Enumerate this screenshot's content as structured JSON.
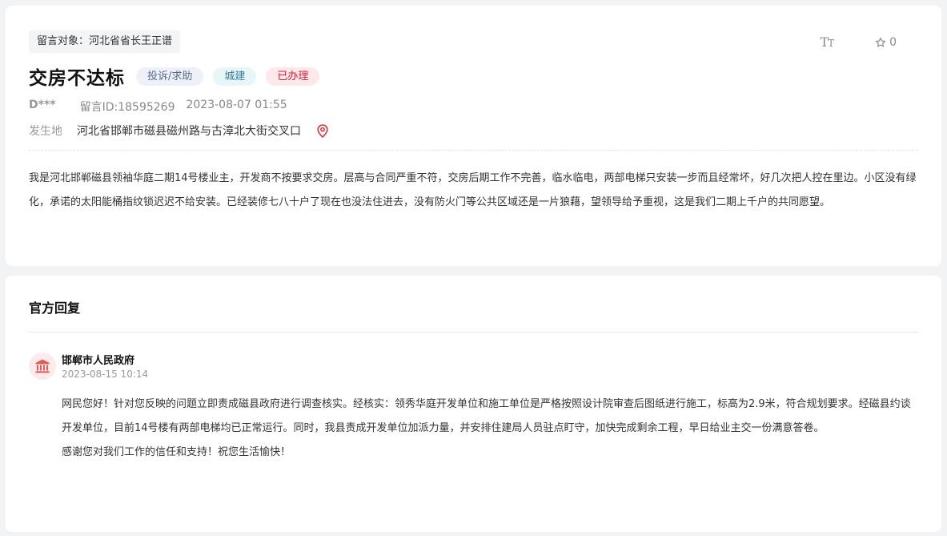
{
  "petition": {
    "target_label": "留言对象：河北省省长王正谱",
    "font_toggle": {
      "big": "T",
      "small": "T"
    },
    "favorite_count": "0",
    "title": "交房不达标",
    "badges": {
      "type": "投诉/求助",
      "category": "城建",
      "status": "已办理"
    },
    "author": "D***",
    "message_id": "留言ID:18595269",
    "datetime": "2023-08-07 01:55",
    "location_label": "发生地",
    "location_value": "河北省邯郸市磁县磁州路与古漳北大街交叉口",
    "content": "我是河北邯郸磁县领袖华庭二期14号楼业主，开发商不按要求交房。层高与合同严重不符，交房后期工作不完善，临水临电，两部电梯只安装一步而且经常坏，好几次把人控在里边。小区没有绿化，承诺的太阳能桶指纹锁迟迟不给安装。已经装修七八十户了现在也没法住进去，没有防火门等公共区域还是一片狼藉，望领导给予重视，这是我们二期上千户的共同愿望。"
  },
  "reply": {
    "heading": "官方回复",
    "org_name": "邯郸市人民政府",
    "datetime": "2023-08-15 10:14",
    "body": "网民您好！针对您反映的问题立即责成磁县政府进行调查核实。经核实：领秀华庭开发单位和施工单位是严格按照设计院审查后图纸进行施工，标高为2.9米，符合规划要求。经磁县约谈开发单位，目前14号楼有两部电梯均已正常运行。同时，我县责成开发单位加派力量，并安排住建局人员驻点盯守，加快完成剩余工程，早日给业主交一份满意答卷。",
    "closing": "感谢您对我们工作的信任和支持！祝您生活愉快！"
  },
  "icons": {
    "font_size": "font-size-icon",
    "favorite": "star-outline-icon",
    "location": "location-pin-icon",
    "org_avatar": "government-building-icon"
  },
  "colors": {
    "location_pin": "#e0303e",
    "status_red": "#d0243a",
    "avatar_bg": "#fdeaea",
    "avatar_icon": "#e05a5a"
  }
}
